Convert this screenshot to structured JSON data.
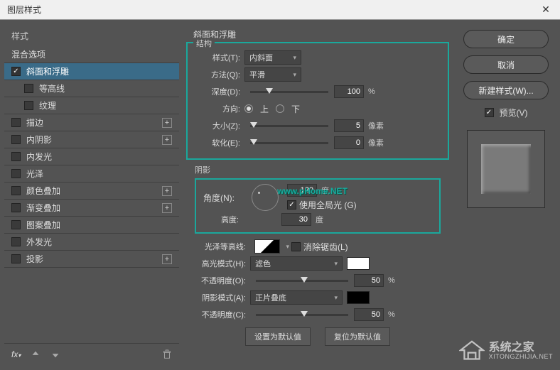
{
  "window": {
    "title": "图层样式"
  },
  "sidebar": {
    "header": "样式",
    "blend_options": "混合选项",
    "items": [
      {
        "label": "斜面和浮雕",
        "checked": true,
        "selected": true,
        "add": false,
        "indent": false
      },
      {
        "label": "等高线",
        "checked": false,
        "selected": false,
        "add": false,
        "indent": true
      },
      {
        "label": "纹理",
        "checked": false,
        "selected": false,
        "add": false,
        "indent": true
      },
      {
        "label": "描边",
        "checked": false,
        "selected": false,
        "add": true,
        "indent": false
      },
      {
        "label": "内阴影",
        "checked": false,
        "selected": false,
        "add": true,
        "indent": false
      },
      {
        "label": "内发光",
        "checked": false,
        "selected": false,
        "add": false,
        "indent": false
      },
      {
        "label": "光泽",
        "checked": false,
        "selected": false,
        "add": false,
        "indent": false
      },
      {
        "label": "颜色叠加",
        "checked": false,
        "selected": false,
        "add": true,
        "indent": false
      },
      {
        "label": "渐变叠加",
        "checked": false,
        "selected": false,
        "add": true,
        "indent": false
      },
      {
        "label": "图案叠加",
        "checked": false,
        "selected": false,
        "add": false,
        "indent": false
      },
      {
        "label": "外发光",
        "checked": false,
        "selected": false,
        "add": false,
        "indent": false
      },
      {
        "label": "投影",
        "checked": false,
        "selected": false,
        "add": true,
        "indent": false
      }
    ]
  },
  "center": {
    "header": "斜面和浮雕",
    "structure": {
      "legend": "结构",
      "style_label": "样式(T):",
      "style_value": "内斜面",
      "method_label": "方法(Q):",
      "method_value": "平滑",
      "depth_label": "深度(D):",
      "depth_value": "100",
      "depth_unit": "%",
      "direction_label": "方向:",
      "up": "上",
      "down": "下",
      "size_label": "大小(Z):",
      "size_value": "5",
      "size_unit": "像素",
      "soften_label": "软化(E):",
      "soften_value": "0",
      "soften_unit": "像素"
    },
    "shading": {
      "legend": "阴影",
      "angle_label": "角度(N):",
      "angle_value": "120",
      "angle_unit": "度",
      "global_light": "使用全局光 (G)",
      "altitude_label": "高度:",
      "altitude_value": "30",
      "altitude_unit": "度",
      "contour_label": "光泽等高线:",
      "antialias": "消除锯齿(L)",
      "highlight_mode_label": "高光模式(H):",
      "highlight_mode_value": "滤色",
      "highlight_opacity_label": "不透明度(O):",
      "highlight_opacity_value": "50",
      "pct": "%",
      "shadow_mode_label": "阴影模式(A):",
      "shadow_mode_value": "正片叠底",
      "shadow_opacity_label": "不透明度(C):",
      "shadow_opacity_value": "50"
    },
    "buttons": {
      "default": "设置为默认值",
      "reset": "复位为默认值"
    }
  },
  "right": {
    "ok": "确定",
    "cancel": "取消",
    "new_style": "新建样式(W)...",
    "preview": "预览(V)"
  },
  "watermark": {
    "url1": "www.pHome.NET",
    "brand_zh": "系统之家",
    "brand_en": "XITONGZHIJIA.NET"
  }
}
